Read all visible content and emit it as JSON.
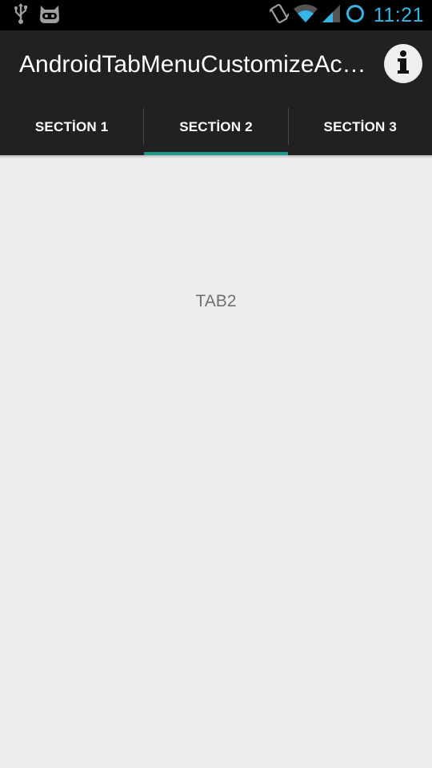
{
  "status_bar": {
    "time": "11:21",
    "icons": [
      "usb-icon",
      "cyanogenmod-icon",
      "vibrate-icon",
      "wifi-icon",
      "signal-icon",
      "sync-icon"
    ],
    "accent_color": "#33b5e5"
  },
  "action_bar": {
    "title": "AndroidTabMenuCustomizeAc…",
    "info_icon": "info-icon"
  },
  "tabs": [
    {
      "label": "SECTİON 1",
      "selected": false
    },
    {
      "label": "SECTİON 2",
      "selected": true
    },
    {
      "label": "SECTİON 3",
      "selected": false
    }
  ],
  "tab_indicator_color": "#1d9b8a",
  "content": {
    "text": "TAB2"
  }
}
